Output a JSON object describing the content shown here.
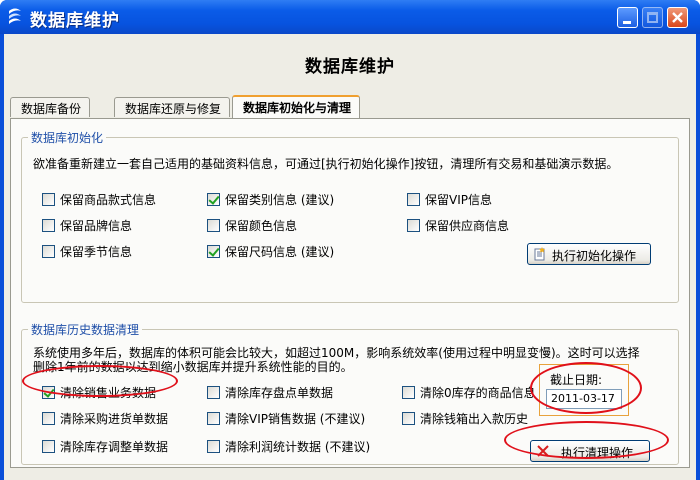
{
  "window": {
    "title": "数据库维护"
  },
  "heading": "数据库维护",
  "tabs": [
    {
      "label": "数据库备份"
    },
    {
      "label": "数据库还原与修复"
    },
    {
      "label": "数据库初始化与清理"
    }
  ],
  "init_group": {
    "legend": "数据库初始化",
    "description": "欲准备重新建立一套自己适用的基础资料信息，可通过[执行初始化操作]按钮，清理所有交易和基础演示数据。",
    "options": [
      {
        "label": "保留商品款式信息",
        "checked": false
      },
      {
        "label": "保留类别信息 (建议)",
        "checked": true
      },
      {
        "label": "保留VIP信息",
        "checked": false
      },
      {
        "label": "保留品牌信息",
        "checked": false
      },
      {
        "label": "保留颜色信息",
        "checked": false
      },
      {
        "label": "保留供应商信息",
        "checked": false
      },
      {
        "label": "保留季节信息",
        "checked": false
      },
      {
        "label": "保留尺码信息 (建议)",
        "checked": true
      }
    ],
    "button": "执行初始化操作"
  },
  "cleanup_group": {
    "legend": "数据库历史数据清理",
    "description_line1": "系统使用多年后，数据库的体积可能会比较大，如超过100M，影响系统效率(使用过程中明显变慢)。这时可以选择",
    "description_line2": "删除1年前的数据以达到缩小数据库并提升系统性能的目的。",
    "options": [
      {
        "label": "清除销售业务数据",
        "checked": true
      },
      {
        "label": "清除库存盘点单数据",
        "checked": false
      },
      {
        "label": "清除0库存的商品信息",
        "checked": false
      },
      {
        "label": "清除采购进货单数据",
        "checked": false
      },
      {
        "label": "清除VIP销售数据 (不建议)",
        "checked": false
      },
      {
        "label": "清除钱箱出入款历史",
        "checked": false
      },
      {
        "label": "清除库存调整单数据",
        "checked": false
      },
      {
        "label": "清除利润统计数据 (不建议)",
        "checked": false
      }
    ],
    "date_label": "截止日期:",
    "date_value": "2011-03-17",
    "button": "执行清理操作"
  },
  "colors": {
    "titlebar": "#0a5ce8",
    "accent_tab": "#f0a030",
    "highlight": "#e0101a",
    "legend_text": "#1f4fa8"
  },
  "icons": [
    "database-app-icon",
    "minimize-icon",
    "maximize-icon",
    "close-icon",
    "init-page-icon",
    "clear-x-icon",
    "checkmark-icon"
  ]
}
